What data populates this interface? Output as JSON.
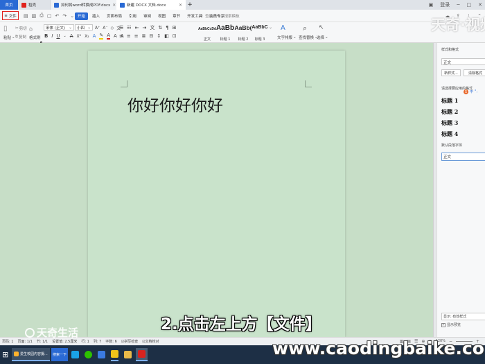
{
  "tabs": [
    {
      "label": "首页",
      "active": false
    },
    {
      "label": "稻壳",
      "active": false
    },
    {
      "label": "如何将word转换成PDF.docx",
      "active": false
    },
    {
      "label": "新建 DOCX 文档.docx",
      "active": true
    }
  ],
  "tab_add_icon": "plus-icon",
  "titlebar_right": {
    "login_label": "登录"
  },
  "file_menu": {
    "label": "文件"
  },
  "menus": [
    "开始",
    "插入",
    "页面布局",
    "引用",
    "审阅",
    "视图",
    "章节",
    "开发工具",
    "会员专享"
  ],
  "active_menu": "开始",
  "search": {
    "placeholder": "查找命令、搜索模板"
  },
  "ribbon": {
    "paste_label": "粘贴",
    "cut_label": "剪切",
    "copy_label": "复制",
    "format_painter_label": "格式刷",
    "font_name": "宋体 (正文)",
    "font_size": "小四",
    "styles": [
      {
        "preview": "AaBbCcDd",
        "label": "正文"
      },
      {
        "preview": "AaBb",
        "label": "标题 1"
      },
      {
        "preview": "AaBb(",
        "label": "标题 2"
      },
      {
        "preview": "AaBbC",
        "label": "标题 3"
      }
    ],
    "text_tools_label": "文字排版",
    "find_replace_label": "查找替换",
    "select_label": "选择"
  },
  "document": {
    "text": "你好你好你好"
  },
  "style_pane": {
    "title": "样式和格式",
    "current_style": "正文",
    "new_style_label": "新样式...",
    "clear_format_label": "清除格式",
    "apply_prompt": "请选择要应用的格式",
    "headings": [
      "标题 1",
      "标题 2",
      "标题 3",
      "标题 4"
    ],
    "default_font_label": "默认段落字体",
    "body_style": "正文",
    "show_label": "显示: 有效样式",
    "preview_label": "显示预览"
  },
  "statusbar": {
    "page_num": "页码: 1",
    "page": "页面: 1/1",
    "section": "节: 1/1",
    "setting": "设置值: 2.5厘米",
    "row": "行: 1",
    "col": "列: 7",
    "words": "字数: 6",
    "spell": "拼写检查",
    "proof": "文档校对",
    "zoom": "120%"
  },
  "taskbar": {
    "item1_label": "爱生校园内容摄...",
    "item2_label": "搜索一下"
  },
  "overlay": {
    "subtitle": "2.点击左上方【文件】",
    "watermark_top": "天奇·视频",
    "watermark_left": "天奇生活",
    "watermark_url": "www.caodingbaike.com"
  },
  "colors": {
    "accent": "#2a6ad4",
    "page_bg": "#c9e3cb",
    "file_highlight": "#e0221c",
    "taskbar": "#1d2f45"
  }
}
